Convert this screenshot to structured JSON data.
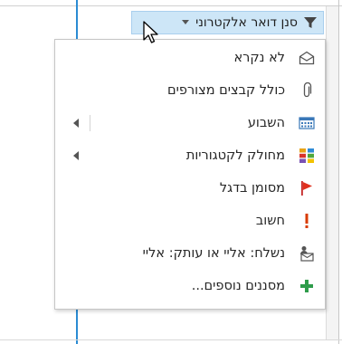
{
  "filter": {
    "label": "סנן דואר אלקטרוני"
  },
  "menu": {
    "items": [
      {
        "id": "unread",
        "label": "לא נקרא",
        "icon": "open-envelope-icon",
        "submenu": false
      },
      {
        "id": "attachments",
        "label": "כולל קבצים מצורפים",
        "icon": "paperclip-icon",
        "submenu": false
      },
      {
        "id": "this-week",
        "label": "השבוע",
        "icon": "calendar-icon",
        "submenu": true
      },
      {
        "id": "categorized",
        "label": "מחולק לקטגוריות",
        "icon": "categories-icon",
        "submenu": true
      },
      {
        "id": "flagged",
        "label": "מסומן בדגל",
        "icon": "flag-icon",
        "submenu": false
      },
      {
        "id": "important",
        "label": "חשוב",
        "icon": "exclamation-icon",
        "submenu": false
      },
      {
        "id": "sent-to",
        "label": "נשלח: אליי או עותק: אליי",
        "icon": "sent-to-me-icon",
        "submenu": false
      },
      {
        "id": "more-filters",
        "label": "מסננים נוספים...",
        "icon": "plus-icon",
        "submenu": false
      }
    ]
  },
  "colors": {
    "filter_bg": "#cde6f7",
    "accent_blue": "#2a8bd3",
    "flag_red": "#e0301e",
    "important_red": "#d83b01",
    "plus_green": "#2e9c4a"
  }
}
